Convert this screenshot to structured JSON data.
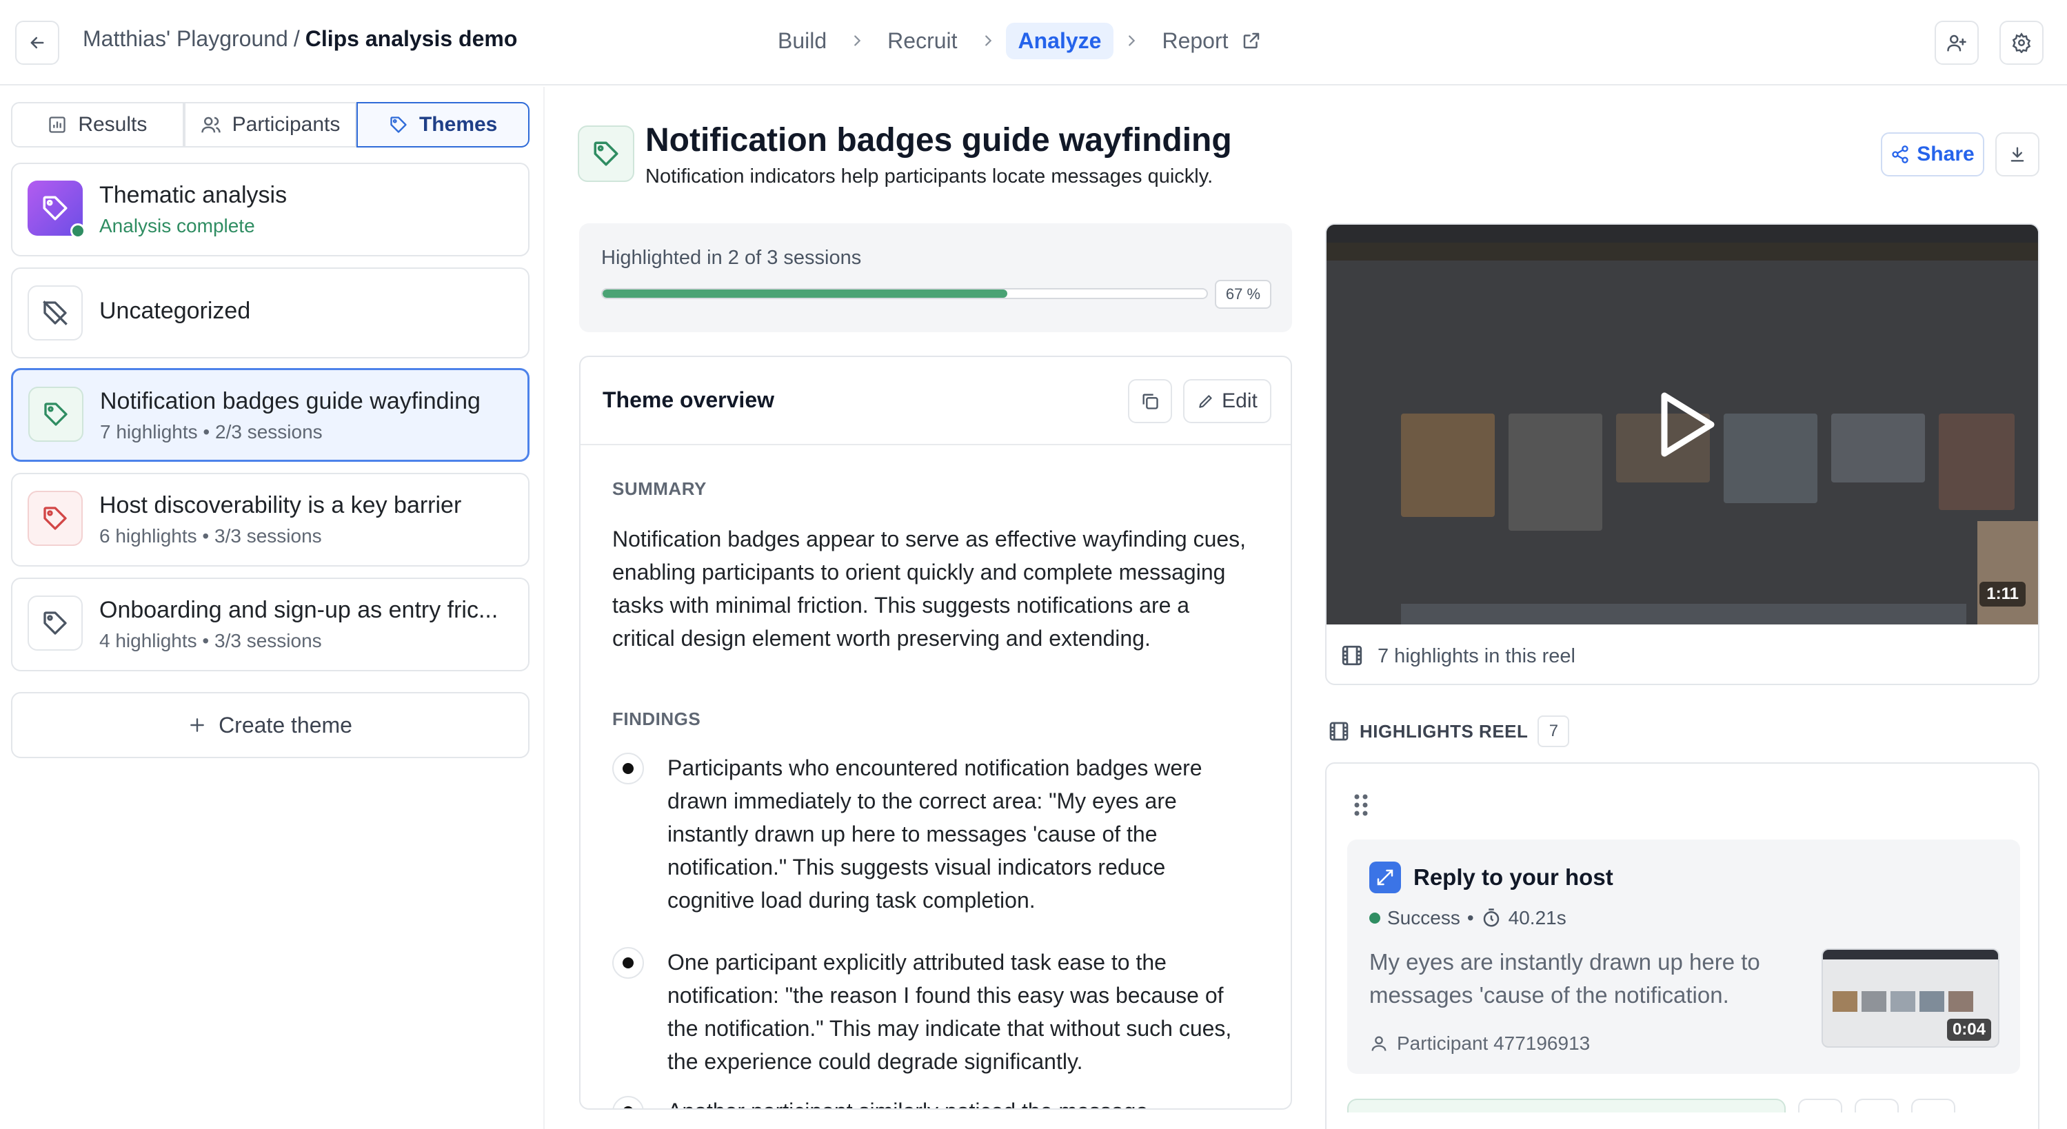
{
  "header": {
    "workspace": "Matthias' Playground",
    "separator": "/",
    "project": "Clips analysis demo",
    "steps": [
      "Build",
      "Recruit",
      "Analyze",
      "Report"
    ],
    "active_step": "Analyze"
  },
  "left": {
    "tabs": [
      {
        "label": "Results",
        "icon": "bar-chart-icon"
      },
      {
        "label": "Participants",
        "icon": "users-icon"
      },
      {
        "label": "Themes",
        "icon": "tag-icon",
        "active": true
      }
    ],
    "cards": [
      {
        "title": "Thematic analysis",
        "subtitle": "Analysis complete"
      },
      {
        "title": "Uncategorized"
      },
      {
        "title": "Notification badges guide wayfinding",
        "subtitle": "7 highlights • 2/3 sessions",
        "selected": true
      },
      {
        "title": "Host discoverability is a key barrier",
        "subtitle": "6 highlights • 3/3 sessions"
      },
      {
        "title": "Onboarding and sign-up as entry fric...",
        "subtitle": "4 highlights • 3/3 sessions"
      }
    ],
    "create_label": "Create theme"
  },
  "theme": {
    "title": "Notification badges guide wayfinding",
    "subtitle": "Notification indicators help participants locate messages quickly.",
    "share_label": "Share",
    "progress": {
      "label": "Highlighted in 2 of 3 sessions",
      "percent": 67,
      "percent_label": "67 %"
    },
    "overview": {
      "title": "Theme overview",
      "edit_label": "Edit",
      "summary_label": "SUMMARY",
      "summary": "Notification badges appear to serve as effective wayfinding cues, enabling participants to orient quickly and complete messaging tasks with minimal friction. This suggests notifications are a critical design element worth preserving and extending.",
      "findings_label": "FINDINGS",
      "findings": [
        "Participants who encountered notification badges were drawn immediately to the correct area: \"My eyes are instantly drawn up here to messages 'cause of the notification.\" This suggests visual indicators reduce cognitive load during task completion.",
        "One participant explicitly attributed task ease to the notification: \"the reason I found this easy was because of the notification.\" This may indicate that without such cues, the experience could degrade significantly.",
        "Another participant similarly noticed the message"
      ]
    }
  },
  "video": {
    "duration": "1:11",
    "reel_count": "7 highlights in this reel"
  },
  "reel": {
    "title": "HIGHLIGHTS REEL",
    "count": "7",
    "clip": {
      "task": "Reply to your host",
      "status": "Success",
      "status_color": "#2f8d62",
      "time": "40.21s",
      "quote": "My eyes are instantly drawn up here to messages 'cause of the notification.",
      "participant": "Participant 477196913",
      "duration": "0:04"
    }
  },
  "colors": {
    "accent": "#2563eb",
    "success": "#4aa374",
    "selected_bg": "#eef4ff"
  }
}
